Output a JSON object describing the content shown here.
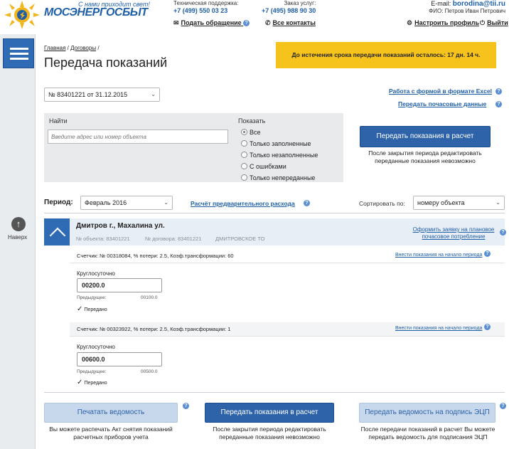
{
  "header": {
    "tagline": "С нами приходит свет!",
    "logo_text": "МОСЭНЕРГОСБЫТ",
    "support_caption": "Техническая поддержка:",
    "support_phone": "+7 (499) 550 03 23",
    "order_caption": "Заказ услуг:",
    "order_phone": "+7 (495) 988 90 30",
    "appeal_link": "Подать обращение",
    "contacts_link": "Все контакты",
    "email_caption": "E-mail:",
    "email": "borodina@tii.ru",
    "fio": "ФИО: Петров Иван Петрович",
    "settings_link": "Настроить профиль",
    "logout_link": "Выйти"
  },
  "left_rail": {
    "up_label": "Наверх"
  },
  "breadcrumb": {
    "home": "Главная",
    "contracts": "Договоры"
  },
  "page_title": "Передача показаний",
  "deadline_banner": "До истечения срока передачи показаний осталось: 17 дн. 14 ч.",
  "contract_select": "№ 83401221 от 31.12.2015",
  "links": {
    "excel": "Работа с формой в формате Excel",
    "hourly": "Передать почасовые данные"
  },
  "filter": {
    "find_label": "Найти",
    "find_placeholder": "Введите адрес или номер объекта",
    "show_label": "Показать",
    "options": [
      "Все",
      "Только заполненные",
      "Только незаполненные",
      "С ошибками",
      "Только непереданные"
    ],
    "selected_index": 0
  },
  "submit_top": {
    "label": "Передать показания в расчет",
    "note": "После закрытия периода редактировать переданные показания невозможно"
  },
  "period": {
    "label": "Период:",
    "value": "Февраль 2016",
    "forecast_link": "Расчёт предварительного расхода",
    "sort_label": "Сортировать по:",
    "sort_value": "номеру объекта"
  },
  "object": {
    "address": "Дмитров г., Махалина ул.",
    "object_no": "№ объекта: 83401221",
    "contract_no": "№ договора: 83401221",
    "district": "ДМИТРОВСКОЕ ТО",
    "request_link": "Оформить заявку на плановое почасовое потребление"
  },
  "meters": [
    {
      "title": "Счетчик: № 00318084, % потери: 2.5, Коэф.трансформации: 60",
      "link": "Внести показания на начало периода",
      "mode": "Круглосуточно",
      "value": "00200.0",
      "prev_label": "Предыдущее:",
      "prev_value": "00100.0",
      "status": "Передано"
    },
    {
      "title": "Счетчик: № 00323922, % потери: 2.5, Коэф.трансформации: 1",
      "link": "Внести показания на начало периода",
      "mode": "Круглосуточно",
      "value": "00600.0",
      "prev_label": "Предыдущее:",
      "prev_value": "00500.0",
      "status": "Передано"
    }
  ],
  "footer": {
    "print_label": "Печатать ведомость",
    "print_note": "Вы можете распечать Акт снятия показаний расчетных приборов учета",
    "submit_label": "Передать показания в расчет",
    "submit_note": "После закрытия периода редактировать переданные показания невозможно",
    "sign_label": "Передать ведомость на подпись ЭЦП",
    "sign_note": "После передачи показаний в расчет Вы можете передать ведомость для подписания ЭЦП"
  },
  "colors": {
    "brand_blue": "#2e63a9",
    "deadline_yellow": "#f6c21c",
    "light_button": "#c7d8ec"
  }
}
